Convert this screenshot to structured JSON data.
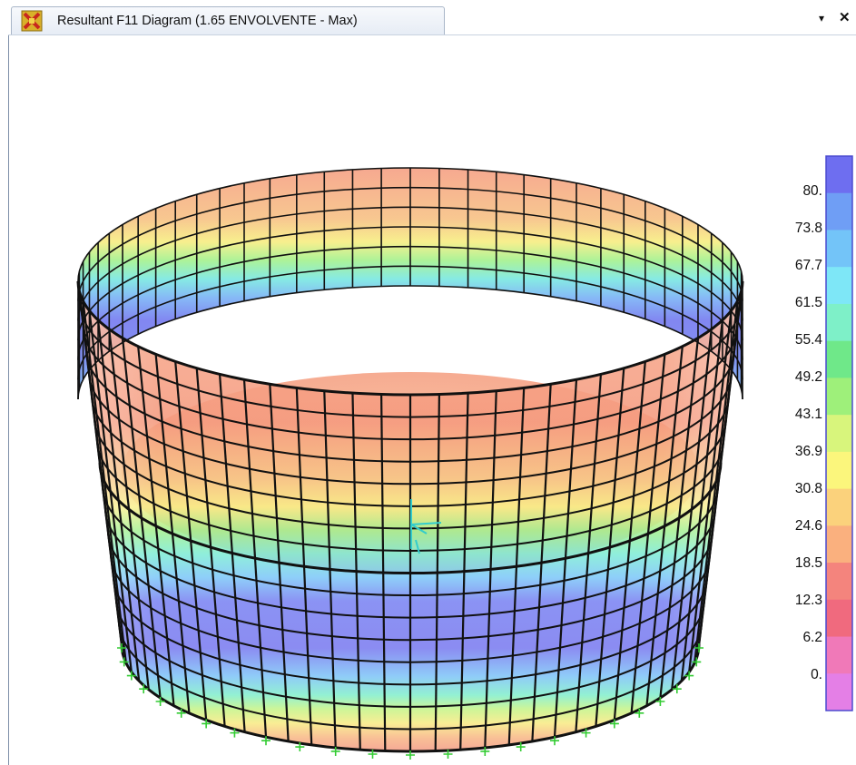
{
  "window": {
    "tab_title": "Resultant F11 Diagram  (1.65 ENVOLVENTE - Max)",
    "menu_glyph": "▾",
    "close_glyph": "✕",
    "icon": "sap-app-icon"
  },
  "legend": {
    "labels": [
      "80.",
      "73.8",
      "67.7",
      "61.5",
      "55.4",
      "49.2",
      "43.1",
      "36.9",
      "30.8",
      "24.6",
      "18.5",
      "12.3",
      "6.2",
      "0."
    ],
    "colors": [
      "#6e6ef0",
      "#6f9ef5",
      "#73c4f8",
      "#7ee7f7",
      "#7ef0c8",
      "#6fe889",
      "#9ef07a",
      "#d8f57c",
      "#fbf67c",
      "#fbd27c",
      "#fab07e",
      "#f4847d",
      "#f06a7e",
      "#f079b8",
      "#e47fe6"
    ]
  },
  "colors": {
    "mesh_line": "#111111",
    "support_marker": "#33cc33",
    "axis_marker": "#33cccc"
  }
}
